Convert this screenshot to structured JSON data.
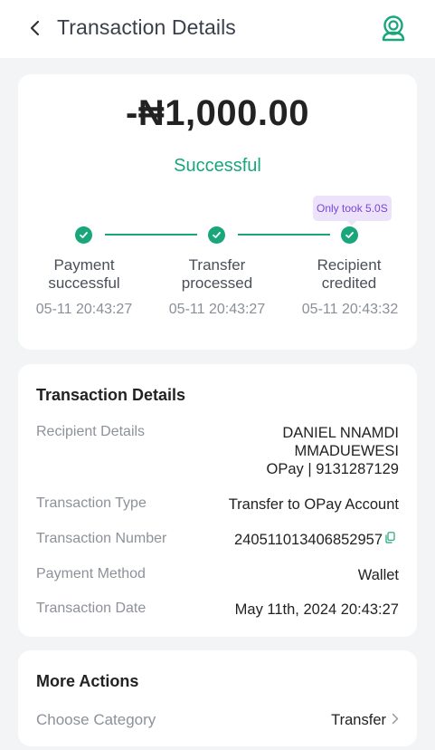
{
  "header": {
    "title": "Transaction Details"
  },
  "summary": {
    "amount": "-₦1,000.00",
    "status": "Successful",
    "badge": "Only took 5.0S",
    "steps": [
      {
        "label_line1": "Payment",
        "label_line2": "successful",
        "time": "05-11 20:43:27"
      },
      {
        "label_line1": "Transfer",
        "label_line2": "processed",
        "time": "05-11 20:43:27"
      },
      {
        "label_line1": "Recipient",
        "label_line2": "credited",
        "time": "05-11 20:43:32"
      }
    ]
  },
  "details": {
    "title": "Transaction Details",
    "recipient_label": "Recipient Details",
    "recipient_line1": "DANIEL NNAMDI",
    "recipient_line2": "MMADUEWESI",
    "recipient_line3": "OPay | 9131287129",
    "type_label": "Transaction Type",
    "type_value": "Transfer to OPay Account",
    "number_label": "Transaction Number",
    "number_value": "240511013406852957",
    "method_label": "Payment Method",
    "method_value": "Wallet",
    "date_label": "Transaction Date",
    "date_value": "May 11th, 2024 20:43:27"
  },
  "actions": {
    "title": "More Actions",
    "category_label": "Choose Category",
    "category_value": "Transfer"
  },
  "colors": {
    "accent": "#1aa67b",
    "badge_bg": "#ece3fb",
    "badge_text": "#7a45d6"
  }
}
